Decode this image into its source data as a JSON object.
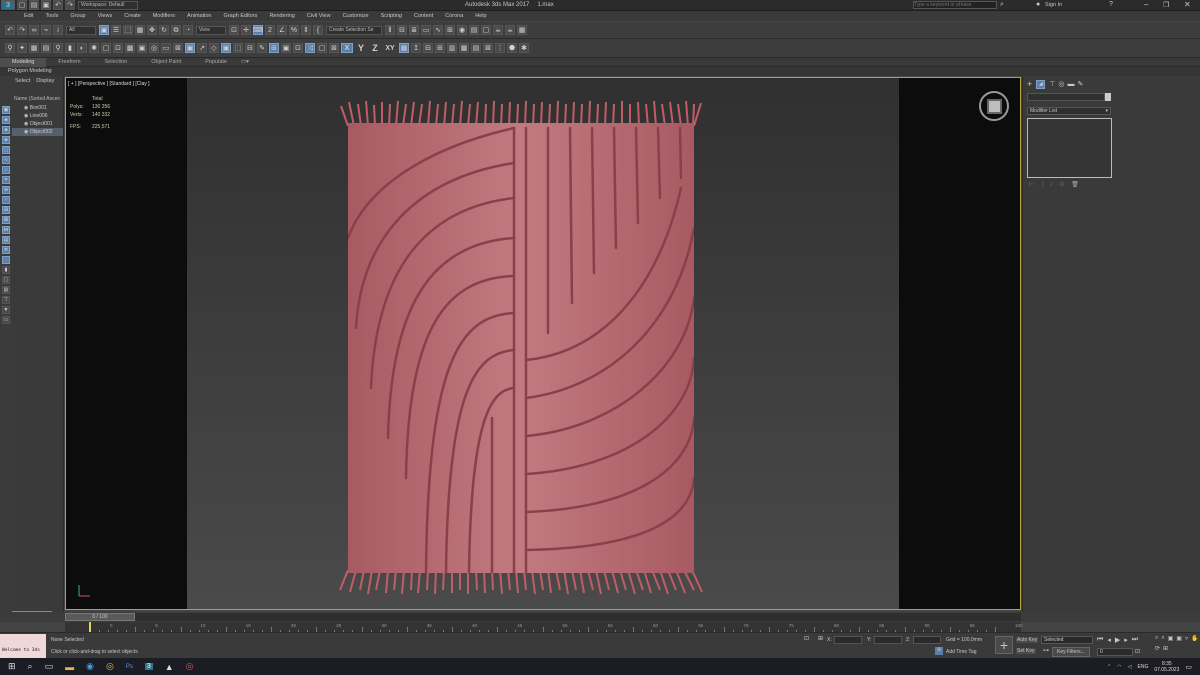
{
  "titlebar": {
    "workspace": "Workspace: Default",
    "title": "Autodesk 3ds Max 2017",
    "file": "1.max",
    "search_placeholder": "Type a keyword or phrase",
    "sign_in": "Sign In"
  },
  "menu": [
    "Edit",
    "Tools",
    "Group",
    "Views",
    "Create",
    "Modifiers",
    "Animation",
    "Graph Editors",
    "Rendering",
    "Civil View",
    "Customize",
    "Scripting",
    "Content",
    "Corona",
    "Help"
  ],
  "toolbar": {
    "filter": "All",
    "view_dropdown": "View",
    "selection_set": "Create Selection Se",
    "axis": [
      "X",
      "Y",
      "Z",
      "XY"
    ]
  },
  "ribbon": {
    "tabs": [
      "Modeling",
      "Freeform",
      "Selection",
      "Object Paint",
      "Populate"
    ],
    "active_label": "Polygon Modeling"
  },
  "scene_explorer": {
    "tabs": [
      "Select",
      "Display"
    ],
    "header": "Name (Sorted Ascen",
    "items": [
      "Box001",
      "Line006",
      "Object001",
      "Object002"
    ]
  },
  "viewport": {
    "label": "[ + ] [Perspective ] [Standard ] [Clay ]",
    "stats": {
      "total_label": "Total",
      "polys_label": "Polys:",
      "polys": "130 256",
      "verts_label": "Verts:",
      "verts": "140 332",
      "fps_label": "FPS:",
      "fps": "225,571"
    }
  },
  "command_panel": {
    "modifier_list": "Modifier List"
  },
  "timeline": {
    "frame": "0 / 100",
    "ticks": [
      "0",
      "5",
      "10",
      "15",
      "20",
      "25",
      "30",
      "35",
      "40",
      "45",
      "50",
      "55",
      "60",
      "65",
      "70",
      "75",
      "80",
      "85",
      "90",
      "95",
      "100"
    ]
  },
  "status": {
    "maxscript": "Welcome to 3ds",
    "selection": "None Selected",
    "prompt": "Click or click-and-drag to select objects",
    "x_label": "X:",
    "y_label": "Y:",
    "z_label": "Z:",
    "grid": "Grid = 100,0mm",
    "add_time_tag": "Add Time Tag",
    "auto_key": "Auto Key",
    "set_key": "Set Key",
    "selected": "Selected",
    "key_filters": "Key Filters...",
    "frame_value": "0"
  },
  "taskbar": {
    "lang": "ENG",
    "time": "8:35",
    "date": "07.05.2023"
  },
  "colors": {
    "rug": "#b66a70",
    "rug_dark": "#8a4048",
    "fringe": "#c65c66",
    "viewport_border": "#b8a23e"
  }
}
